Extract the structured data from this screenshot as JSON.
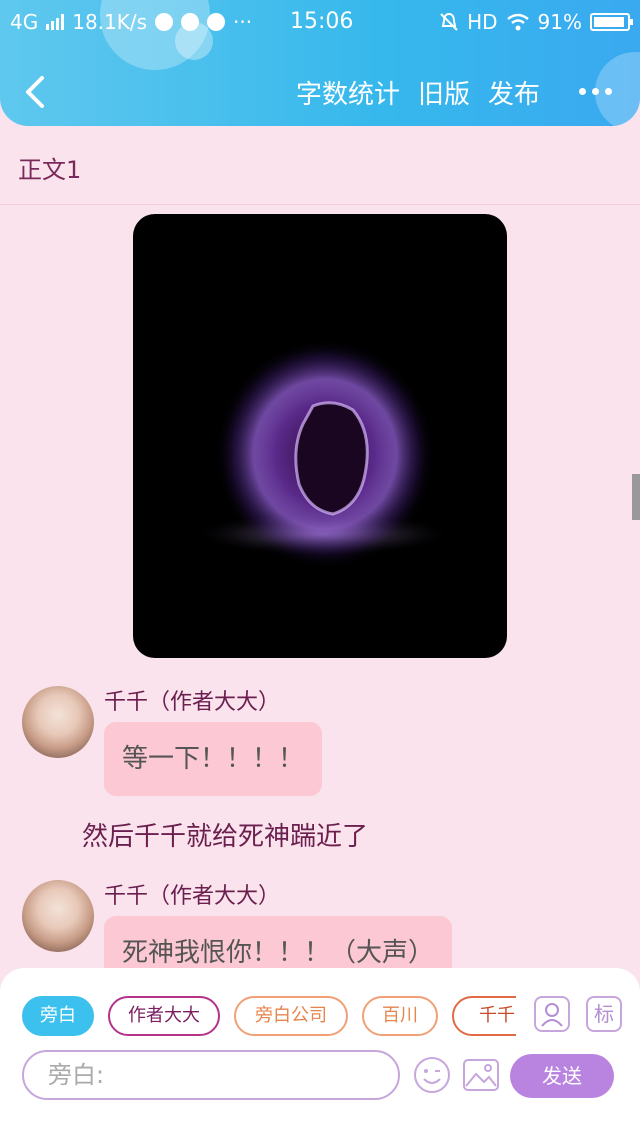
{
  "status_bar": {
    "network": "4G",
    "speed": "18.1K/s",
    "time": "15:06",
    "hd": "HD",
    "battery": "91%"
  },
  "nav": {
    "word_count": "字数统计",
    "old_version": "旧版",
    "publish": "发布"
  },
  "section_title": "正文1",
  "messages": [
    {
      "name": "千千（作者大大）",
      "text": "等一下！！！！"
    },
    {
      "name": "千千（作者大大）",
      "text": "死神我恨你！！！（大声）"
    }
  ],
  "narration": "然后千千就给死神踹近了",
  "roles": [
    "旁白",
    "作者大大",
    "旁白公司",
    "百川",
    "千千"
  ],
  "tools": {
    "tag_icon_label": "标"
  },
  "input": {
    "placeholder": "旁白:"
  },
  "send_label": "发送",
  "colors": {
    "header_blue": "#36b8ec",
    "page_bg": "#fae3ec",
    "bubble_pink": "#fbc8d3",
    "send_purple": "#b983e0"
  }
}
